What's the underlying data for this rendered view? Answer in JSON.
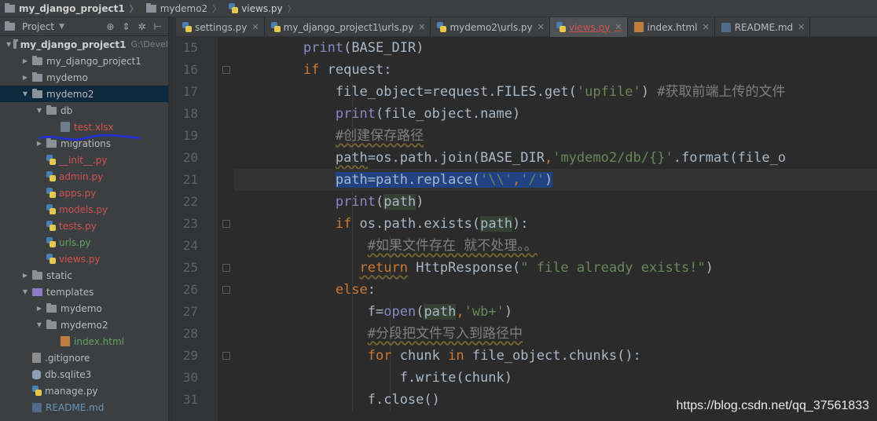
{
  "breadcrumbs": [
    {
      "label": "my_django_project1",
      "icon": "folder-icon",
      "bold": true
    },
    {
      "label": "mydemo2",
      "icon": "folder-icon"
    },
    {
      "label": "views.py",
      "icon": "python-file-icon",
      "current": true
    }
  ],
  "project_panel": {
    "title": "Project",
    "tree": [
      {
        "label": "my_django_project1",
        "path": "G:\\Devel",
        "depth": 0,
        "type": "folder",
        "open": true,
        "bold": true
      },
      {
        "label": "my_django_project1",
        "depth": 1,
        "type": "folder",
        "open": false
      },
      {
        "label": "mydemo",
        "depth": 1,
        "type": "folder",
        "open": false
      },
      {
        "label": "mydemo2",
        "depth": 1,
        "type": "folder",
        "open": true,
        "selected": true
      },
      {
        "label": "db",
        "depth": 2,
        "type": "folder",
        "open": true
      },
      {
        "label": "test.xlsx",
        "depth": 3,
        "type": "xlsx",
        "color": "red"
      },
      {
        "label": "migrations",
        "depth": 2,
        "type": "folder",
        "open": false
      },
      {
        "label": "__init__.py",
        "depth": 2,
        "type": "py",
        "color": "red"
      },
      {
        "label": "admin.py",
        "depth": 2,
        "type": "py",
        "color": "red"
      },
      {
        "label": "apps.py",
        "depth": 2,
        "type": "py",
        "color": "red"
      },
      {
        "label": "models.py",
        "depth": 2,
        "type": "py",
        "color": "red"
      },
      {
        "label": "tests.py",
        "depth": 2,
        "type": "py",
        "color": "red"
      },
      {
        "label": "urls.py",
        "depth": 2,
        "type": "py",
        "color": "green"
      },
      {
        "label": "views.py",
        "depth": 2,
        "type": "py",
        "color": "red"
      },
      {
        "label": "static",
        "depth": 1,
        "type": "folder",
        "open": false
      },
      {
        "label": "templates",
        "depth": 1,
        "type": "template-folder",
        "open": true
      },
      {
        "label": "mydemo",
        "depth": 2,
        "type": "folder",
        "open": false
      },
      {
        "label": "mydemo2",
        "depth": 2,
        "type": "folder",
        "open": true
      },
      {
        "label": "index.html",
        "depth": 3,
        "type": "html",
        "color": "green"
      },
      {
        "label": ".gitignore",
        "depth": 1,
        "type": "file"
      },
      {
        "label": "db.sqlite3",
        "depth": 1,
        "type": "db"
      },
      {
        "label": "manage.py",
        "depth": 1,
        "type": "py"
      },
      {
        "label": "README.md",
        "depth": 1,
        "type": "md",
        "color": "blue"
      }
    ]
  },
  "tabs": [
    {
      "label": "settings.py",
      "icon": "python-file-icon"
    },
    {
      "label": "my_django_project1\\urls.py",
      "icon": "python-file-icon"
    },
    {
      "label": "mydemo2\\urls.py",
      "icon": "python-file-icon"
    },
    {
      "label": "views.py",
      "icon": "python-file-icon",
      "active": true
    },
    {
      "label": "index.html",
      "icon": "html-file-icon"
    },
    {
      "label": "README.md",
      "icon": "markdown-file-icon"
    }
  ],
  "editor": {
    "line_numbers": [
      15,
      16,
      17,
      18,
      19,
      20,
      21,
      22,
      23,
      24,
      25,
      26,
      27,
      28,
      29,
      30,
      31
    ],
    "lines": [
      [
        {
          "t": "        "
        },
        {
          "t": "print",
          "c": "bi"
        },
        {
          "t": "(BASE_DIR)"
        }
      ],
      [
        {
          "t": "        "
        },
        {
          "t": "if",
          "c": "kw"
        },
        {
          "t": " request:"
        }
      ],
      [
        {
          "t": "            file_object=request.FILES.get("
        },
        {
          "t": "'upfile'",
          "c": "str"
        },
        {
          "t": ") "
        },
        {
          "t": "#获取前端上传的文件",
          "c": "cm"
        }
      ],
      [
        {
          "t": "            "
        },
        {
          "t": "print",
          "c": "bi"
        },
        {
          "t": "(file_object.name)"
        }
      ],
      [
        {
          "t": "            "
        },
        {
          "t": "#创建保存路径",
          "c": "cm squig"
        }
      ],
      [
        {
          "t": "            "
        },
        {
          "t": "path",
          "c": "squig"
        },
        {
          "t": "=os.path.join(BASE_DIR"
        },
        {
          "t": ",",
          "c": "kw"
        },
        {
          "t": "'mydemo2/db/{}'",
          "c": "str"
        },
        {
          "t": ".format(file_o"
        }
      ],
      [
        {
          "t": "            "
        },
        {
          "t": "path=path.replace(",
          "c": "sel"
        },
        {
          "t": "'\\\\'",
          "c": "str sel"
        },
        {
          "t": ",",
          "c": "kw sel"
        },
        {
          "t": "'/'",
          "c": "str sel"
        },
        {
          "t": ")",
          "c": "sel"
        }
      ],
      [
        {
          "t": "            "
        },
        {
          "t": "print",
          "c": "bi"
        },
        {
          "t": "("
        },
        {
          "t": "path",
          "c": "hl-path"
        },
        {
          "t": ")"
        }
      ],
      [
        {
          "t": "            "
        },
        {
          "t": "if",
          "c": "kw"
        },
        {
          "t": " os.path.exists("
        },
        {
          "t": "path",
          "c": "hl-path"
        },
        {
          "t": "):"
        }
      ],
      [
        {
          "t": "                "
        },
        {
          "t": "#如果文件存在 就不处理。。",
          "c": "cm squig"
        }
      ],
      [
        {
          "t": "               "
        },
        {
          "t": "return",
          "c": "kw squig"
        },
        {
          "t": " HttpResponse("
        },
        {
          "t": "\" file already exists!\"",
          "c": "str"
        },
        {
          "t": ")"
        }
      ],
      [
        {
          "t": "            "
        },
        {
          "t": "else",
          "c": "kw"
        },
        {
          "t": ":"
        }
      ],
      [
        {
          "t": "                f="
        },
        {
          "t": "open",
          "c": "bi"
        },
        {
          "t": "("
        },
        {
          "t": "path",
          "c": "hl-path"
        },
        {
          "t": ",",
          "c": "kw"
        },
        {
          "t": "'wb+'",
          "c": "str"
        },
        {
          "t": ")"
        }
      ],
      [
        {
          "t": "                "
        },
        {
          "t": "#分段把文件写入到路径中",
          "c": "cm squig"
        }
      ],
      [
        {
          "t": "                "
        },
        {
          "t": "for",
          "c": "kw"
        },
        {
          "t": " chunk "
        },
        {
          "t": "in",
          "c": "kw"
        },
        {
          "t": " file_object.chunks():"
        }
      ],
      [
        {
          "t": "                    f.write(chunk)"
        }
      ],
      [
        {
          "t": "                f.close()"
        }
      ]
    ],
    "current_line_index": 6
  },
  "watermark": "https://blog.csdn.net/qq_37561833"
}
